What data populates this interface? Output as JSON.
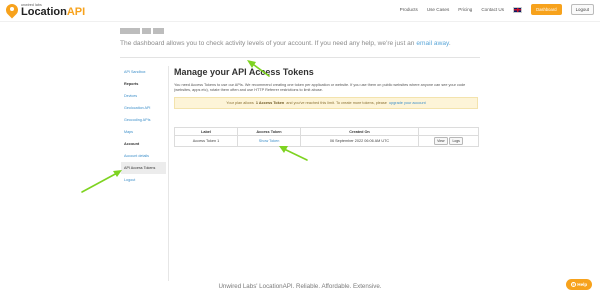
{
  "brand": {
    "small": "unwired labs",
    "name_part1": "Location",
    "name_part2": "API",
    "accent": "#f7a21c"
  },
  "nav": {
    "links": [
      "Products",
      "Use Cases",
      "Pricing",
      "Contact Us"
    ],
    "dashboard_label": "Dashboard",
    "logout_label": "Logout"
  },
  "header": {
    "lead_text": "The dashboard allows you to check activity levels of your account. If you need any help, we're just an ",
    "lead_link": "email away",
    "lead_end": "."
  },
  "sidebar": {
    "items": [
      {
        "label": "API Sandbox",
        "type": "link"
      },
      {
        "label": "Reports",
        "type": "head"
      },
      {
        "label": "Devices",
        "type": "link"
      },
      {
        "label": "Geolocation API",
        "type": "link"
      },
      {
        "label": "Geocoding APIs",
        "type": "link"
      },
      {
        "label": "Maps",
        "type": "link"
      },
      {
        "label": "Account",
        "type": "head"
      },
      {
        "label": "Account details",
        "type": "link"
      },
      {
        "label": "API Access Tokens",
        "type": "active"
      },
      {
        "label": "Logout",
        "type": "link"
      }
    ]
  },
  "main": {
    "title": "Manage your API Access Tokens",
    "description": "You need Access Tokens to use our APIs. We recommend creating one token per application or website. If you use them on public websites where anyone can see your code (websites, apps etc), rotate them often and use HTTP Referrer restrictions to limit abuse.",
    "notice_pre": "Your plan allows",
    "notice_bold": "1 Access Token",
    "notice_mid": "and you've reached this limit. To create more tokens, please",
    "notice_link": "upgrade your account"
  },
  "table": {
    "headers": [
      "Label",
      "Access Token",
      "Created On",
      ""
    ],
    "rows": [
      {
        "label": "Access Token 1",
        "token": "Show Token",
        "created": "06 September 2022 06:06 AM UTC",
        "view": "View",
        "logs": "Logs"
      }
    ]
  },
  "footer": {
    "text": "Unwired Labs' LocationAPI. Reliable. Affordable. Extensive."
  },
  "help": {
    "label": "Help",
    "icon": "?"
  },
  "colors": {
    "link": "#3b8ec9",
    "arrow": "#7ed321",
    "notice_bg": "#fdf4d8"
  }
}
